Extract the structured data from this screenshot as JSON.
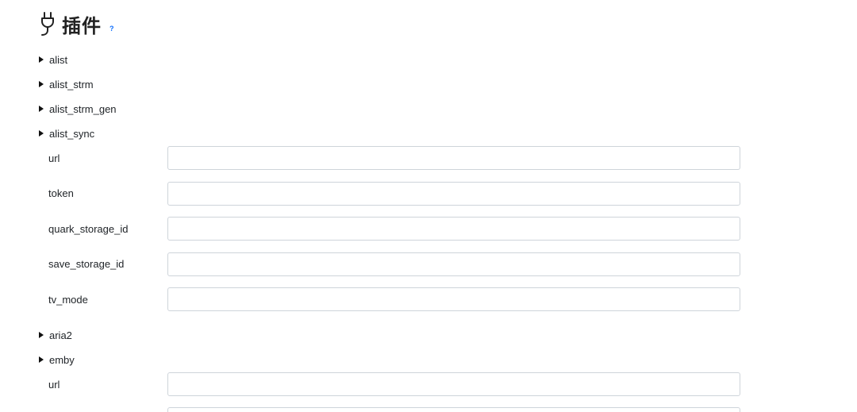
{
  "header": {
    "title": "插件",
    "help": "?"
  },
  "plugins": [
    {
      "name": "alist"
    },
    {
      "name": "alist_strm"
    },
    {
      "name": "alist_strm_gen"
    },
    {
      "name": "alist_sync"
    },
    {
      "name": "aria2"
    },
    {
      "name": "emby"
    }
  ],
  "alist_sync_fields": [
    {
      "label": "url",
      "value": ""
    },
    {
      "label": "token",
      "value": ""
    },
    {
      "label": "quark_storage_id",
      "value": ""
    },
    {
      "label": "save_storage_id",
      "value": ""
    },
    {
      "label": "tv_mode",
      "value": ""
    }
  ],
  "emby_fields": [
    {
      "label": "url",
      "value": ""
    }
  ]
}
